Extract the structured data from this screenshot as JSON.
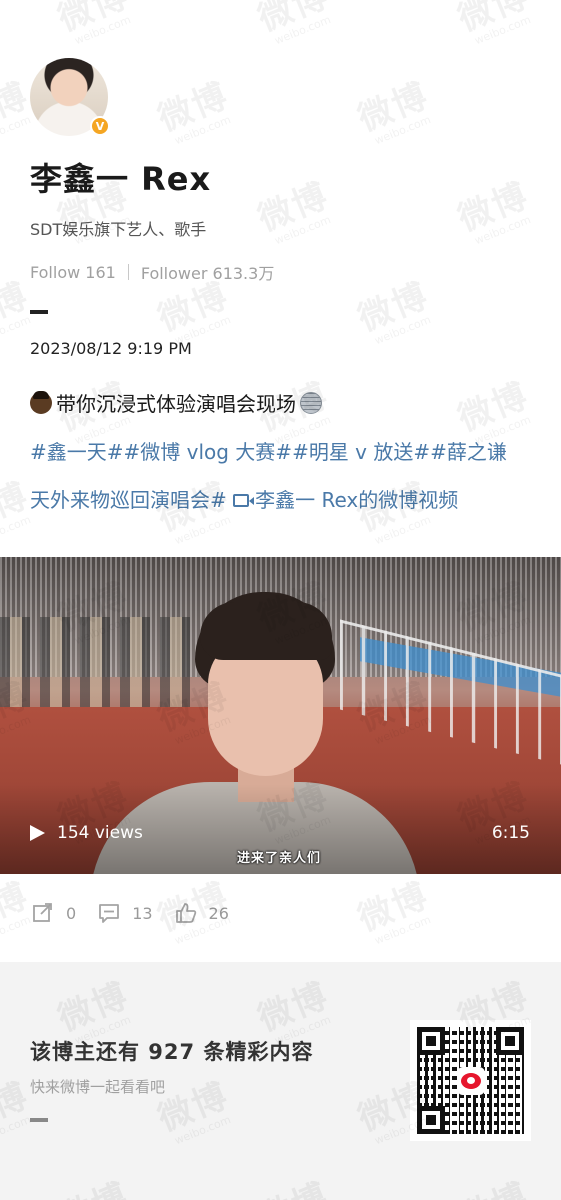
{
  "watermark": {
    "cn": "微博",
    "en": "weibo.com"
  },
  "profile": {
    "name": "李鑫一 Rex",
    "bio": "SDT娱乐旗下艺人、歌手",
    "follow": "Follow 161",
    "follower": "Follower 613.3万",
    "verified_icon": "verified-v-icon"
  },
  "post": {
    "date": "2023/08/12 9:19 PM",
    "text": "带你沉浸式体验演唱会现场",
    "tags_line1": "#鑫一天##微博 vlog 大赛##明星 v 放送##薛之谦",
    "tags_line2": "天外来物巡回演唱会#",
    "video_link": "李鑫一 Rex的微博视频"
  },
  "video": {
    "views": "154 views",
    "duration": "6:15",
    "subtitle": "进来了亲人们"
  },
  "actions": {
    "repost": "0",
    "comment": "13",
    "like": "26"
  },
  "footer": {
    "title": "该博主还有 927 条精彩内容",
    "subtitle": "快来微博一起看看吧"
  },
  "colors": {
    "tag_blue": "#4a79a8",
    "footer_bg": "#f3f3f3",
    "verified_orange": "#f5a623"
  }
}
